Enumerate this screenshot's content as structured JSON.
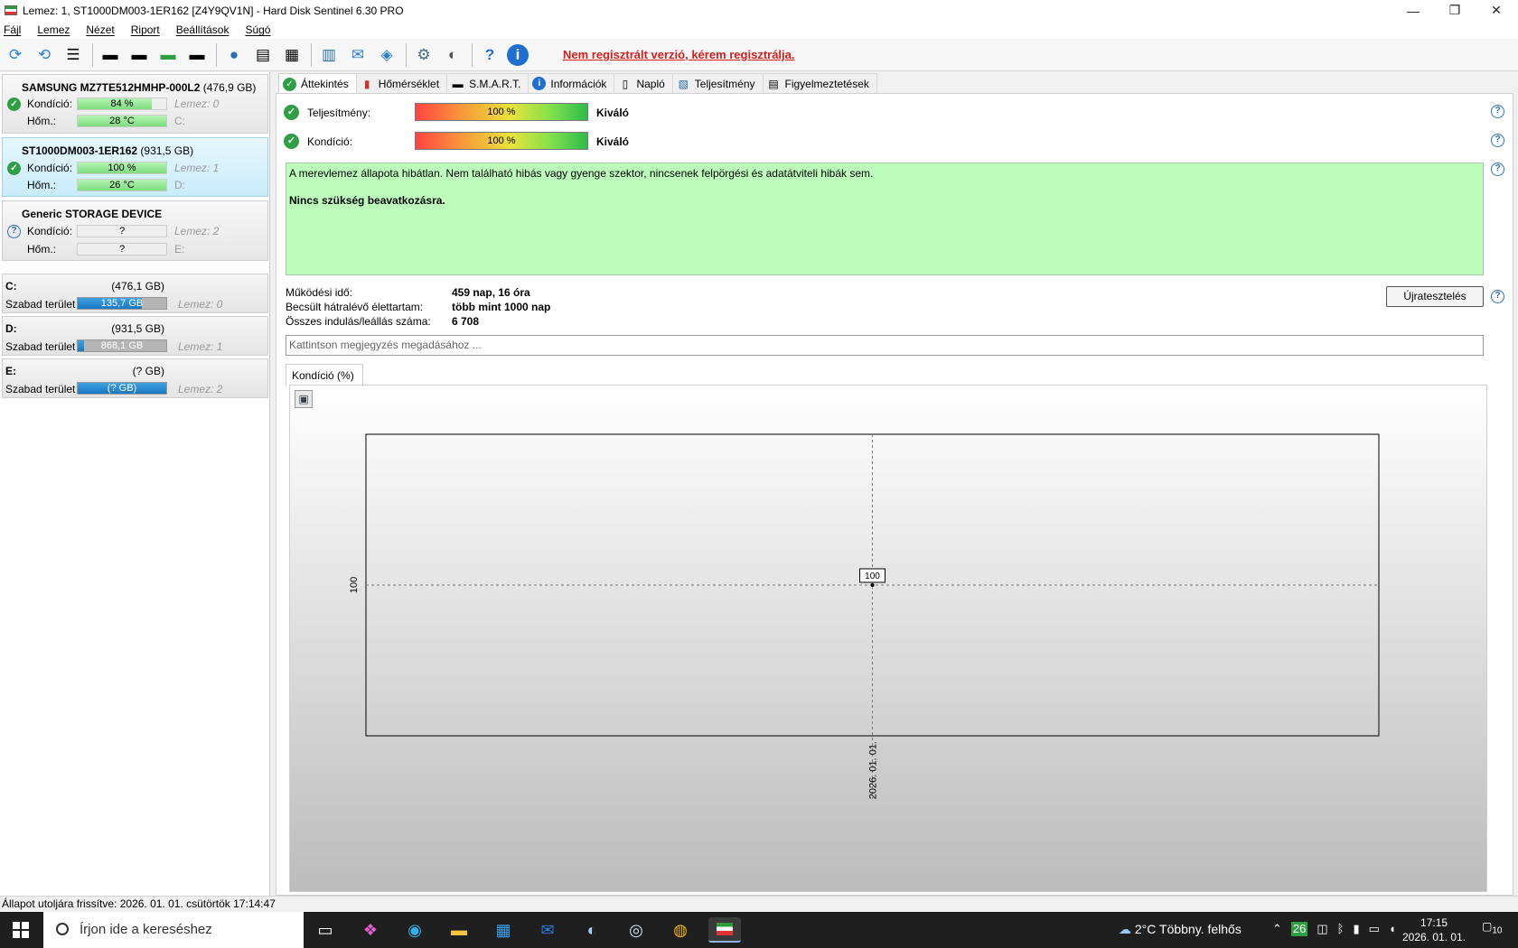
{
  "window": {
    "title": "Lemez: 1, ST1000DM003-1ER162 [Z4Y9QV1N]  -  Hard Disk Sentinel 6.30 PRO"
  },
  "menu": [
    "Fájl",
    "Lemez",
    "Nézet",
    "Riport",
    "Beállítások",
    "Súgó"
  ],
  "toolbar": {
    "unregistered": "Nem regisztrált verzió, kérem regisztrálja."
  },
  "disks": [
    {
      "name": "SAMSUNG MZ7TE512HMHP-000L2",
      "size": "(476,9 GB)",
      "cond_label": "Kondíció:",
      "cond": "84 %",
      "cond_pct": 84,
      "temp_label": "Hőm.:",
      "temp": "28 °C",
      "disk": "Lemez: 0",
      "drive": "C:"
    },
    {
      "name": "ST1000DM003-1ER162",
      "size": "(931,5 GB)",
      "cond_label": "Kondíció:",
      "cond": "100 %",
      "cond_pct": 100,
      "temp_label": "Hőm.:",
      "temp": "26 °C",
      "disk": "Lemez: 1",
      "drive": "D:"
    },
    {
      "name": "Generic STORAGE DEVICE",
      "size": "",
      "cond_label": "Kondíció:",
      "cond": "?",
      "cond_pct": 0,
      "temp_label": "Hőm.:",
      "temp": "?",
      "disk": "Lemez: 2",
      "drive": "E:"
    }
  ],
  "volumes": [
    {
      "letter": "C:",
      "size": "(476,1 GB)",
      "free_label": "Szabad terület",
      "free": "135,7 GB",
      "used_pct": 72,
      "disk": "Lemez: 0"
    },
    {
      "letter": "D:",
      "size": "(931,5 GB)",
      "free_label": "Szabad terület",
      "free": "868,1 GB",
      "used_pct": 7,
      "disk": "Lemez: 1"
    },
    {
      "letter": "E:",
      "size": "(? GB)",
      "free_label": "Szabad terület",
      "free": "(? GB)",
      "used_pct": 100,
      "disk": "Lemez: 2"
    }
  ],
  "tabs": [
    "Áttekintés",
    "Hőmérséklet",
    "S.M.A.R.T.",
    "Információk",
    "Napló",
    "Teljesítmény",
    "Figyelmeztetések"
  ],
  "overview": {
    "perf_label": "Teljesítmény:",
    "perf": "100 %",
    "perf_rating": "Kiváló",
    "cond_label": "Kondíció:",
    "cond": "100 %",
    "cond_rating": "Kiváló",
    "status_line1": "A merevlemez állapota hibátlan. Nem található hibás vagy gyenge szektor, nincsenek felpörgési és adatátviteli hibák sem.",
    "status_line2": "Nincs szükség beavatkozásra.",
    "uptime_label": "Működési idő:",
    "uptime": "459 nap, 16 óra",
    "life_label": "Becsült hátralévő élettartam:",
    "life": "több mint 1000 nap",
    "starts_label": "Összes indulás/leállás száma:",
    "starts": "6 708",
    "retest": "Újratesztelés",
    "note_placeholder": "Kattintson megjegyzés megadásához ...",
    "chart_tab": "Kondíció  (%)"
  },
  "chart_data": {
    "type": "line",
    "x": [
      "2026. 01. 01."
    ],
    "series": [
      {
        "values": [
          100
        ]
      }
    ],
    "data_labels": [
      "100"
    ],
    "y_tick": "100",
    "ylabel": "",
    "xlabel": "",
    "grid": true
  },
  "statusbar": "Állapot utoljára frissítve: 2026. 01. 01. csütörtök 17:14:47",
  "taskbar": {
    "search": "Írjon ide a kereséshez",
    "weather": "2°C  Többny. felhős",
    "badge": "26",
    "time": "17:15",
    "date": "2026. 01. 01.",
    "notifications": "10"
  }
}
